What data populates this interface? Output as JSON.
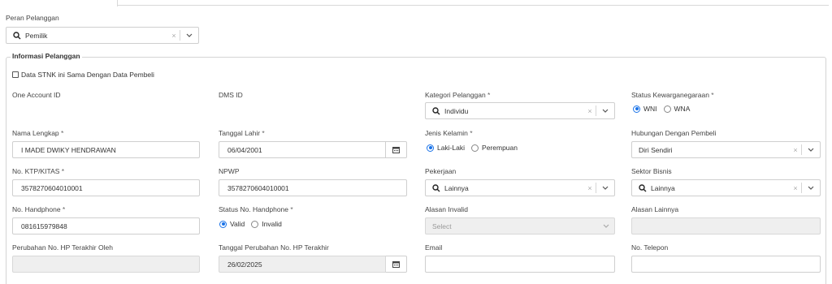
{
  "peran": {
    "label": "Peran Pelanggan",
    "value": "Pemilik"
  },
  "section": {
    "title": "Informasi Pelanggan"
  },
  "stnk_checkbox": {
    "label": "Data STNK ini Sama Dengan Data Pembeli",
    "checked": false
  },
  "one_account": {
    "label": "One Account ID"
  },
  "dms": {
    "label": "DMS ID"
  },
  "kategori": {
    "label": "Kategori Pelanggan",
    "value": "Individu"
  },
  "kewarganegaraan": {
    "label": "Status Kewarganegaraan",
    "options": [
      "WNI",
      "WNA"
    ],
    "selected": "WNI"
  },
  "nama": {
    "label": "Nama Lengkap",
    "value": "I MADE DWIKY HENDRAWAN"
  },
  "tanggal_lahir": {
    "label": "Tanggal Lahir",
    "value": "06/04/2001"
  },
  "jenis_kelamin": {
    "label": "Jenis Kelamin",
    "options": [
      "Laki-Laki",
      "Perempuan"
    ],
    "selected": "Laki-Laki"
  },
  "hubungan": {
    "label": "Hubungan Dengan Pembeli",
    "value": "Diri Sendiri"
  },
  "ktp": {
    "label": "No. KTP/KITAS",
    "value": "3578270604010001"
  },
  "npwp": {
    "label": "NPWP",
    "value": "3578270604010001"
  },
  "pekerjaan": {
    "label": "Pekerjaan",
    "value": "Lainnya"
  },
  "sektor": {
    "label": "Sektor Bisnis",
    "value": "Lainnya"
  },
  "handphone": {
    "label": "No. Handphone",
    "value": "081615979848"
  },
  "status_hp": {
    "label": "Status No. Handphone",
    "options": [
      "Valid",
      "Invalid"
    ],
    "selected": "Valid"
  },
  "alasan_invalid": {
    "label": "Alasan Invalid",
    "placeholder": "Select"
  },
  "alasan_lainnya": {
    "label": "Alasan Lainnya",
    "value": ""
  },
  "perubahan_oleh": {
    "label": "Perubahan No. HP Terakhir Oleh",
    "value": ""
  },
  "tanggal_perubahan": {
    "label": "Tanggal Perubahan No. HP Terakhir",
    "value": "26/02/2025"
  },
  "email": {
    "label": "Email",
    "value": ""
  },
  "telepon": {
    "label": "No. Telepon",
    "value": ""
  },
  "colors": {
    "accent": "#1a73e8",
    "border": "#cfcfcf",
    "disabled_bg": "#efefef"
  }
}
